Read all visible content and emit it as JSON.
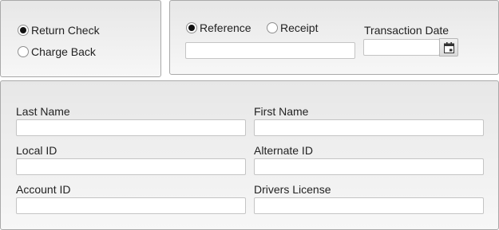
{
  "return_type": {
    "options": [
      {
        "label": "Return Check",
        "selected": true
      },
      {
        "label": "Charge Back",
        "selected": false
      }
    ]
  },
  "lookup": {
    "options": [
      {
        "label": "Reference",
        "selected": true
      },
      {
        "label": "Receipt",
        "selected": false
      }
    ],
    "reference_value": "",
    "transaction_date_label": "Transaction Date",
    "transaction_date_value": "",
    "calendar_icon": "calendar-icon"
  },
  "customer": {
    "last_name_label": "Last Name",
    "last_name_value": "",
    "first_name_label": "First Name",
    "first_name_value": "",
    "local_id_label": "Local ID",
    "local_id_value": "",
    "alternate_id_label": "Alternate ID",
    "alternate_id_value": "",
    "account_id_label": "Account ID",
    "account_id_value": "",
    "drivers_license_label": "Drivers License",
    "drivers_license_value": ""
  },
  "colors": {
    "panel_border": "#a9a9a9",
    "input_border": "#c4c4c4",
    "text": "#222222"
  }
}
